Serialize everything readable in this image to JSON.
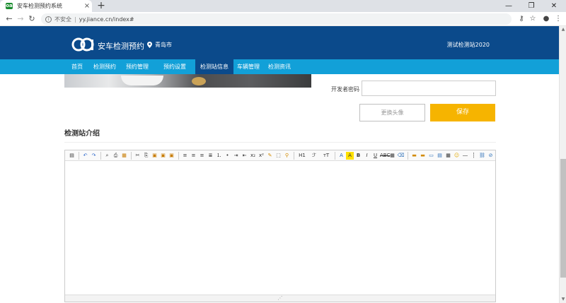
{
  "browser": {
    "tab_title": "安车检测预约系统",
    "favicon_text": "oa",
    "close_glyph": "×",
    "new_tab_glyph": "+",
    "security_label": "不安全",
    "url": "yy.jiance.cn/index#",
    "icons": [
      "back-icon",
      "forward-icon",
      "reload-icon",
      "key-icon",
      "star-icon",
      "account-icon",
      "menu-icon",
      "minimize-icon",
      "maximize-icon",
      "close-icon"
    ]
  },
  "header": {
    "logo_text": "安车检测预约",
    "location": "青岛市",
    "user_name": "测试检测站2020",
    "brand_color": "#0b4a8b"
  },
  "nav": {
    "accent_color": "#12a0d8",
    "active_index": 4,
    "items": [
      {
        "label": "首页"
      },
      {
        "label": "检测预约"
      },
      {
        "label": "预约管理"
      },
      {
        "label": "预约设置"
      },
      {
        "label": "检测站信息"
      },
      {
        "label": "车辆管理"
      },
      {
        "label": "检测资讯"
      }
    ]
  },
  "form": {
    "developer_password_label": "开发者密码",
    "developer_password_value": "",
    "change_avatar_label": "更换头像",
    "save_label": "保存",
    "save_color": "#f6b400"
  },
  "intro": {
    "section_title": "检测站介绍",
    "editor_content": "",
    "toolbar_buttons": [
      "source",
      "undo",
      "redo",
      "preview",
      "print",
      "template",
      "cut",
      "copy",
      "paste",
      "paste-text",
      "paste-word",
      "align-left",
      "align-center",
      "align-right",
      "align-justify",
      "ordered-list",
      "unordered-list",
      "indent",
      "outdent",
      "subscript",
      "superscript",
      "clear-format",
      "select-all",
      "heading",
      "font-name",
      "font-size",
      "font-color",
      "highlight",
      "bold",
      "italic",
      "underline",
      "strikethrough",
      "line-height",
      "remove-format",
      "image",
      "multi-image",
      "flash",
      "media",
      "table",
      "emoticon",
      "horizontal-rule",
      "page-break",
      "link",
      "unlink"
    ]
  }
}
